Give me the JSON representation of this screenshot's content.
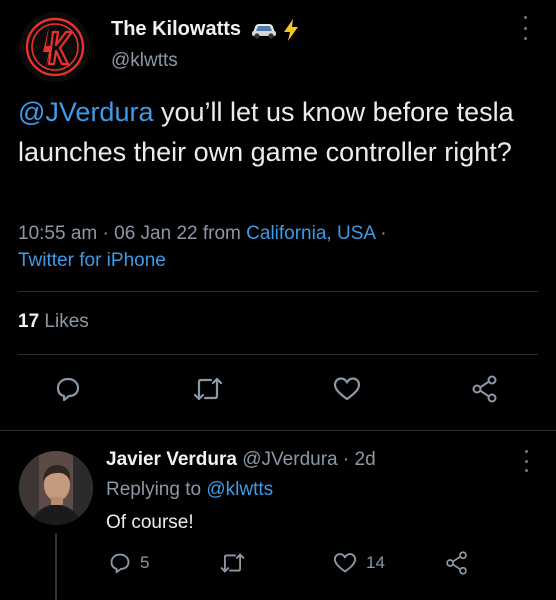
{
  "tweet": {
    "author": {
      "name": "The Kilowatts",
      "handle": "@klwtts",
      "name_emojis": [
        "car-emoji",
        "lightning-emoji"
      ]
    },
    "text": {
      "mention": "@JVerdura",
      "body": " you’ll let us know before tesla launches their own game controller right?"
    },
    "time": "10:55 am",
    "date": "06 Jan 22",
    "from_label": "from",
    "location": "California, USA",
    "source": "Twitter for iPhone",
    "likes_count": "17",
    "likes_label": "Likes",
    "actions": [
      "reply-icon",
      "retweet-icon",
      "like-icon",
      "share-icon"
    ]
  },
  "reply": {
    "name": "Javier Verdura",
    "handle": "@JVerdura",
    "age": "2d",
    "replying_label": "Replying to",
    "replying_handle": "@klwtts",
    "text": "Of course!",
    "reply_count": "5",
    "like_count": "14"
  },
  "colors": {
    "background": "#000000",
    "link": "#3d9be9",
    "secondary": "#8b98a5",
    "brand_red": "#e8322b"
  }
}
